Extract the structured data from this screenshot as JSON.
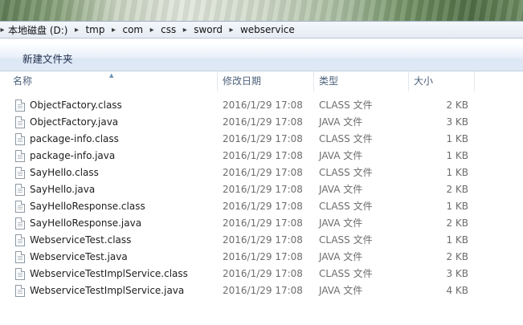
{
  "breadcrumb": [
    {
      "label": "本地磁盘 (D:)"
    },
    {
      "label": "tmp"
    },
    {
      "label": "com"
    },
    {
      "label": "css"
    },
    {
      "label": "sword"
    },
    {
      "label": "webservice"
    }
  ],
  "toolbar": {
    "new_folder_label": "新建文件夹"
  },
  "columns": {
    "name": "名称",
    "date": "修改日期",
    "type": "类型",
    "size": "大小"
  },
  "files": [
    {
      "name": "ObjectFactory.class",
      "date": "2016/1/29 17:08",
      "type": "CLASS 文件",
      "size": "2 KB"
    },
    {
      "name": "ObjectFactory.java",
      "date": "2016/1/29 17:08",
      "type": "JAVA 文件",
      "size": "3 KB"
    },
    {
      "name": "package-info.class",
      "date": "2016/1/29 17:08",
      "type": "CLASS 文件",
      "size": "1 KB"
    },
    {
      "name": "package-info.java",
      "date": "2016/1/29 17:08",
      "type": "JAVA 文件",
      "size": "1 KB"
    },
    {
      "name": "SayHello.class",
      "date": "2016/1/29 17:08",
      "type": "CLASS 文件",
      "size": "1 KB"
    },
    {
      "name": "SayHello.java",
      "date": "2016/1/29 17:08",
      "type": "JAVA 文件",
      "size": "2 KB"
    },
    {
      "name": "SayHelloResponse.class",
      "date": "2016/1/29 17:08",
      "type": "CLASS 文件",
      "size": "1 KB"
    },
    {
      "name": "SayHelloResponse.java",
      "date": "2016/1/29 17:08",
      "type": "JAVA 文件",
      "size": "2 KB"
    },
    {
      "name": "WebserviceTest.class",
      "date": "2016/1/29 17:08",
      "type": "CLASS 文件",
      "size": "1 KB"
    },
    {
      "name": "WebserviceTest.java",
      "date": "2016/1/29 17:08",
      "type": "JAVA 文件",
      "size": "2 KB"
    },
    {
      "name": "WebserviceTestImplService.class",
      "date": "2016/1/29 17:08",
      "type": "CLASS 文件",
      "size": "3 KB"
    },
    {
      "name": "WebserviceTestImplService.java",
      "date": "2016/1/29 17:08",
      "type": "JAVA 文件",
      "size": "4 KB"
    }
  ]
}
